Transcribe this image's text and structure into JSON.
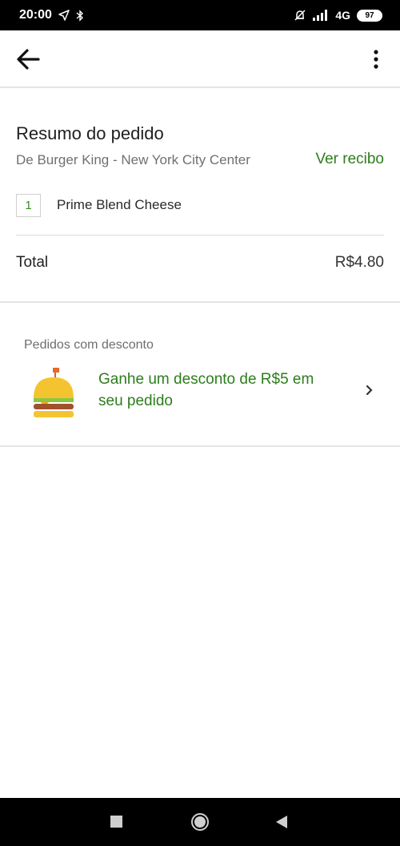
{
  "status_bar": {
    "time": "20:00",
    "network": "4G",
    "battery": "97",
    "icons": [
      "navigation-icon",
      "bluetooth-icon",
      "alarm-off-icon",
      "signal-icon"
    ]
  },
  "app_bar": {
    "back_icon": "arrow-left-icon",
    "menu_icon": "more-vertical-icon"
  },
  "order_summary": {
    "title": "Resumo do pedido",
    "restaurant": "De Burger King - New York City Center",
    "receipt_link": "Ver recibo",
    "items": [
      {
        "quantity": "1",
        "name": "Prime Blend Cheese"
      }
    ],
    "total_label": "Total",
    "total_value": "R$4.80"
  },
  "promo": {
    "header": "Pedidos com desconto",
    "text": "Ganhe um desconto de R$5 em seu pedido",
    "icon": "burger-icon"
  },
  "colors": {
    "accent_green": "#2d7d1c",
    "divider": "#e4e4e4"
  },
  "nav_bar": {
    "icons": [
      "recents-square-icon",
      "home-circle-icon",
      "back-triangle-icon"
    ]
  }
}
